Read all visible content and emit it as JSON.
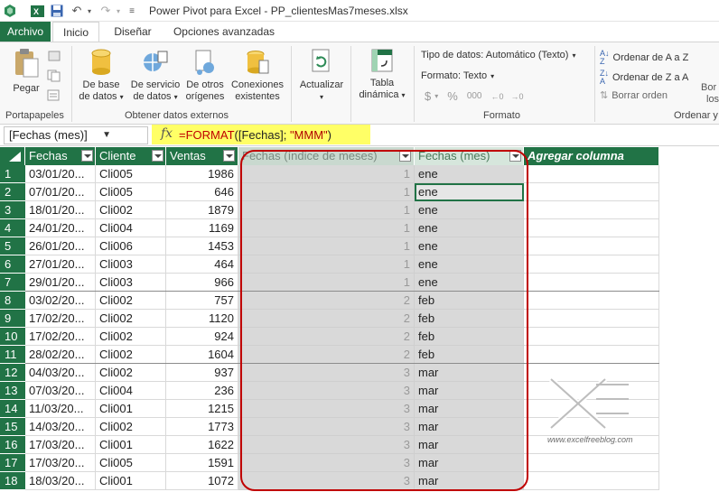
{
  "window": {
    "title": "Power Pivot para Excel - PP_clientesMas7meses.xlsx"
  },
  "tabs": [
    {
      "label": "Archivo"
    },
    {
      "label": "Inicio"
    },
    {
      "label": "Diseñar"
    },
    {
      "label": "Opciones avanzadas"
    }
  ],
  "ribbon": {
    "paste": {
      "label": "Pegar"
    },
    "group_clipboard": "Portapapeles",
    "from_db": {
      "line1": "De base",
      "line2": "de datos"
    },
    "from_service": {
      "line1": "De servicio",
      "line2": "de datos"
    },
    "from_other": {
      "line1": "De otros",
      "line2": "orígenes"
    },
    "existing_conn": {
      "line1": "Conexiones",
      "line2": "existentes"
    },
    "group_external": "Obtener datos externos",
    "refresh": {
      "label": "Actualizar"
    },
    "pivot": {
      "line1": "Tabla",
      "line2": "dinámica"
    },
    "datatype": "Tipo de datos: Automático (Texto)",
    "format": "Formato: Texto",
    "group_format": "Formato",
    "sort_az": "Ordenar de A a Z",
    "sort_za": "Ordenar de Z a A",
    "clear_sort": "Borrar orden",
    "group_sort": "Ordenar y",
    "cut_off_b1": "Bor",
    "cut_off_b2": "los"
  },
  "formula_bar": {
    "name_box": "[Fechas (mes)]",
    "fx_symbol": "fx",
    "formula_parts": {
      "p1": "=FORMAT",
      "p2": "([Fechas]; ",
      "p3": "\"MMM\"",
      "p4": ")"
    }
  },
  "table": {
    "columns": [
      {
        "label": "Fechas"
      },
      {
        "label": "Cliente"
      },
      {
        "label": "Ventas"
      },
      {
        "label": "Fechas (índice de meses)"
      },
      {
        "label": "Fechas (mes)"
      },
      {
        "label": "Agregar columna"
      }
    ],
    "rows": [
      {
        "n": "1",
        "fecha": "03/01/20...",
        "cliente": "Cli005",
        "ventas": "1986",
        "idx": "1",
        "mes": "ene"
      },
      {
        "n": "2",
        "fecha": "07/01/20...",
        "cliente": "Cli005",
        "ventas": "646",
        "idx": "1",
        "mes": "ene"
      },
      {
        "n": "3",
        "fecha": "18/01/20...",
        "cliente": "Cli002",
        "ventas": "1879",
        "idx": "1",
        "mes": "ene"
      },
      {
        "n": "4",
        "fecha": "24/01/20...",
        "cliente": "Cli004",
        "ventas": "1169",
        "idx": "1",
        "mes": "ene"
      },
      {
        "n": "5",
        "fecha": "26/01/20...",
        "cliente": "Cli006",
        "ventas": "1453",
        "idx": "1",
        "mes": "ene"
      },
      {
        "n": "6",
        "fecha": "27/01/20...",
        "cliente": "Cli003",
        "ventas": "464",
        "idx": "1",
        "mes": "ene"
      },
      {
        "n": "7",
        "fecha": "29/01/20...",
        "cliente": "Cli003",
        "ventas": "966",
        "idx": "1",
        "mes": "ene"
      },
      {
        "n": "8",
        "fecha": "03/02/20...",
        "cliente": "Cli002",
        "ventas": "757",
        "idx": "2",
        "mes": "feb"
      },
      {
        "n": "9",
        "fecha": "17/02/20...",
        "cliente": "Cli002",
        "ventas": "1120",
        "idx": "2",
        "mes": "feb"
      },
      {
        "n": "10",
        "fecha": "17/02/20...",
        "cliente": "Cli002",
        "ventas": "924",
        "idx": "2",
        "mes": "feb"
      },
      {
        "n": "11",
        "fecha": "28/02/20...",
        "cliente": "Cli002",
        "ventas": "1604",
        "idx": "2",
        "mes": "feb"
      },
      {
        "n": "12",
        "fecha": "04/03/20...",
        "cliente": "Cli002",
        "ventas": "937",
        "idx": "3",
        "mes": "mar"
      },
      {
        "n": "13",
        "fecha": "07/03/20...",
        "cliente": "Cli004",
        "ventas": "236",
        "idx": "3",
        "mes": "mar"
      },
      {
        "n": "14",
        "fecha": "11/03/20...",
        "cliente": "Cli001",
        "ventas": "1215",
        "idx": "3",
        "mes": "mar"
      },
      {
        "n": "15",
        "fecha": "14/03/20...",
        "cliente": "Cli002",
        "ventas": "1773",
        "idx": "3",
        "mes": "mar"
      },
      {
        "n": "16",
        "fecha": "17/03/20...",
        "cliente": "Cli001",
        "ventas": "1622",
        "idx": "3",
        "mes": "mar"
      },
      {
        "n": "17",
        "fecha": "17/03/20...",
        "cliente": "Cli005",
        "ventas": "1591",
        "idx": "3",
        "mes": "mar"
      },
      {
        "n": "18",
        "fecha": "18/03/20...",
        "cliente": "Cli001",
        "ventas": "1072",
        "idx": "3",
        "mes": "mar"
      }
    ]
  },
  "watermark": {
    "text": "www.excelfreeblog.com"
  },
  "colors": {
    "excel_green": "#217346",
    "formula_highlight": "#ffff66",
    "callout_red": "#c00000"
  }
}
